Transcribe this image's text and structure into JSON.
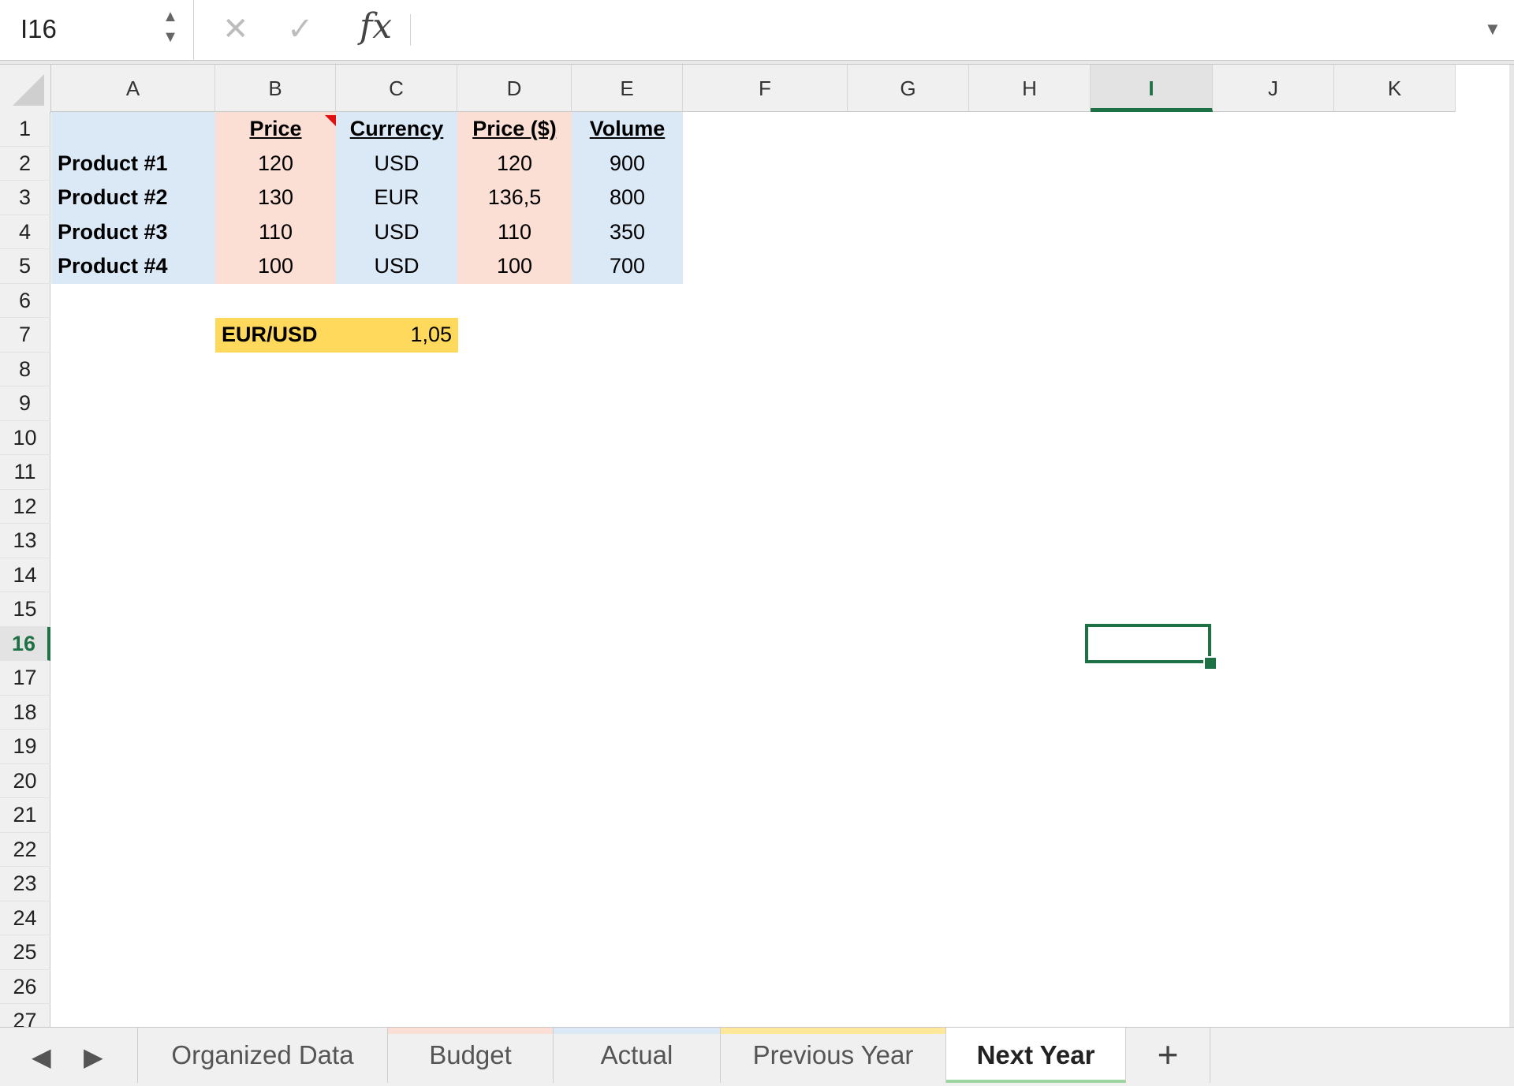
{
  "formula_bar": {
    "name_box": "I16",
    "formula": "",
    "fx_label": "fx",
    "cancel_glyph": "✕",
    "enter_glyph": "✓",
    "spin_up": "▲",
    "spin_down": "▼",
    "expand_glyph": "▼"
  },
  "columns": [
    "A",
    "B",
    "C",
    "D",
    "E",
    "F",
    "G",
    "H",
    "I",
    "J",
    "K"
  ],
  "rows": [
    "1",
    "2",
    "3",
    "4",
    "5",
    "6",
    "7",
    "8",
    "9",
    "10",
    "11",
    "12",
    "13",
    "14",
    "15",
    "16",
    "17",
    "18",
    "19",
    "20",
    "21",
    "22",
    "23",
    "24",
    "25",
    "26",
    "27"
  ],
  "selected_cell": {
    "column": "I",
    "row": "16"
  },
  "table": {
    "headers": {
      "price": "Price",
      "currency": "Currency",
      "price_usd": "Price ($)",
      "volume": "Volume"
    },
    "products": [
      {
        "name": "Product #1",
        "price": "120",
        "currency": "USD",
        "price_usd": "120",
        "volume": "900"
      },
      {
        "name": "Product #2",
        "price": "130",
        "currency": "EUR",
        "price_usd": "136,5",
        "volume": "800"
      },
      {
        "name": "Product #3",
        "price": "110",
        "currency": "USD",
        "price_usd": "110",
        "volume": "350"
      },
      {
        "name": "Product #4",
        "price": "100",
        "currency": "USD",
        "price_usd": "100",
        "volume": "700"
      }
    ]
  },
  "fx_rate": {
    "label": "EUR/USD",
    "value": "1,05"
  },
  "sheet_tabs": {
    "prev_glyph": "◀",
    "next_glyph": "▶",
    "add_glyph": "+",
    "tabs": [
      {
        "label": "Organized Data",
        "stripe": ""
      },
      {
        "label": "Budget",
        "stripe": "#fbdfd4"
      },
      {
        "label": "Actual",
        "stripe": "#dbe8f5"
      },
      {
        "label": "Previous Year",
        "stripe": "#ffe79a"
      },
      {
        "label": "Next Year",
        "stripe": ""
      }
    ],
    "active_tab": "Next Year"
  },
  "colors": {
    "accent": "#1e7145",
    "blue_fill": "#dbe8f5",
    "peach_fill": "#fbdfd4",
    "yellow_fill": "#ffd95b",
    "comment_marker": "#e01010"
  }
}
